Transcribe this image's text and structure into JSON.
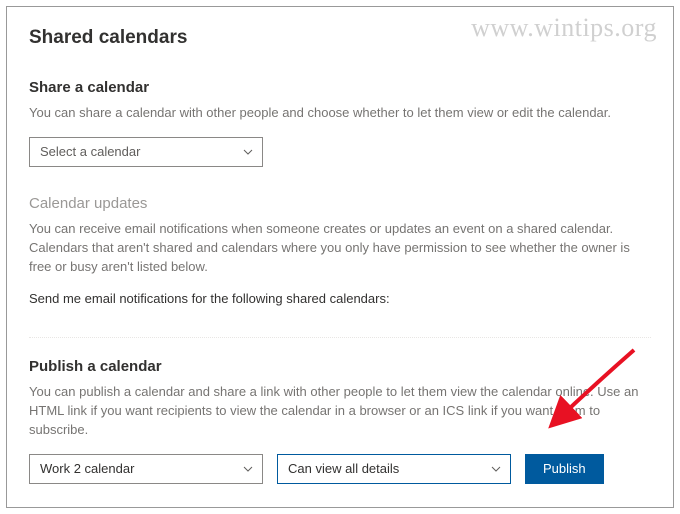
{
  "watermark": "www.wintips.org",
  "page_title": "Shared calendars",
  "share": {
    "heading": "Share a calendar",
    "description": "You can share a calendar with other people and choose whether to let them view or edit the calendar.",
    "dropdown_placeholder": "Select a calendar"
  },
  "updates": {
    "heading": "Calendar updates",
    "description": "You can receive email notifications when someone creates or updates an event on a shared calendar. Calendars that aren't shared and calendars where you only have permission to see whether the owner is free or busy aren't listed below.",
    "prompt": "Send me email notifications for the following shared calendars:"
  },
  "publish": {
    "heading": "Publish a calendar",
    "description": "You can publish a calendar and share a link with other people to let them view the calendar online. Use an HTML link if you want recipients to view the calendar in a browser or an ICS link if you want them to subscribe.",
    "calendar_value": "Work 2 calendar",
    "permissions_value": "Can view all details",
    "button_label": "Publish"
  }
}
